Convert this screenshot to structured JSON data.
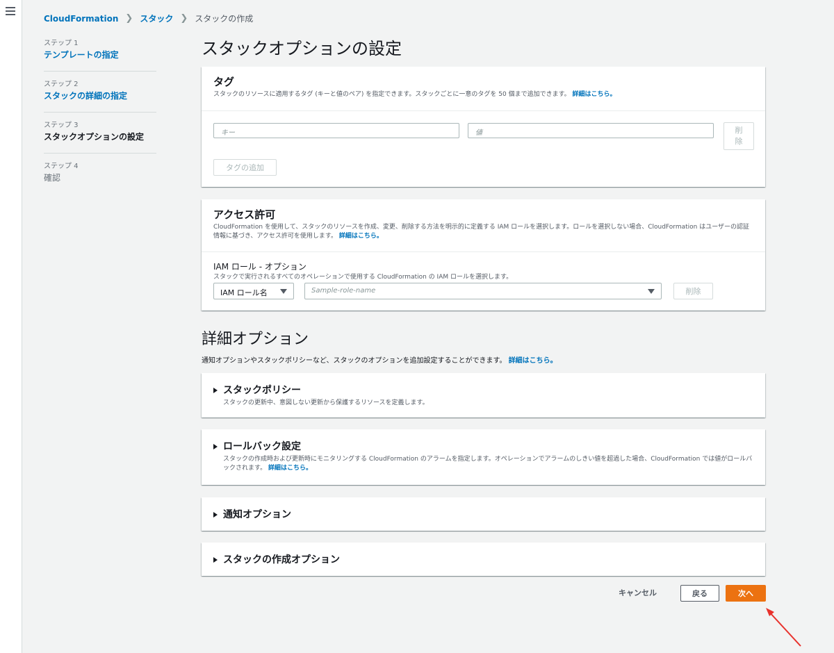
{
  "breadcrumb": {
    "root": "CloudFormation",
    "stacks": "スタック",
    "current": "スタックの作成"
  },
  "steps": [
    {
      "num": "ステップ 1",
      "label": "テンプレートの指定",
      "state": "link"
    },
    {
      "num": "ステップ 2",
      "label": "スタックの詳細の指定",
      "state": "link"
    },
    {
      "num": "ステップ 3",
      "label": "スタックオプションの設定",
      "state": "active"
    },
    {
      "num": "ステップ 4",
      "label": "確認",
      "state": "disabled"
    }
  ],
  "page_title": "スタックオプションの設定",
  "tags": {
    "title": "タグ",
    "desc": "スタックのリソースに適用するタグ (キーと値のペア) を指定できます。スタックごとに一意のタグを 50 個まで追加できます。",
    "link": "詳細はこちら。",
    "key_placeholder": "キー",
    "value_placeholder": "値",
    "remove_label": "削除",
    "add_label": "タグの追加"
  },
  "access": {
    "title": "アクセス許可",
    "desc": "CloudFormation を使用して、スタックのリソースを作成、変更、削除する方法を明示的に定義する IAM ロールを選択します。ロールを選択しない場合、CloudFormation はユーザーの認証情報に基づき、アクセス許可を使用します。",
    "link": "詳細はこちら。",
    "role_label": "IAM ロール - オプション",
    "role_desc": "スタックで実行されるすべてのオペレーションで使用する CloudFormation の IAM ロールを選択します。",
    "role_type": "IAM ロール名",
    "role_placeholder": "Sample-role-name",
    "remove_label": "削除"
  },
  "advanced": {
    "title": "詳細オプション",
    "desc": "通知オプションやスタックポリシーなど、スタックのオプションを追加設定することができます。",
    "link": "詳細はこちら。",
    "policy_title": "スタックポリシー",
    "policy_desc": "スタックの更新中、意図しない更新から保護するリソースを定義します。",
    "rollback_title": "ロールバック設定",
    "rollback_desc": "スタックの作成時および更新時にモニタリングする CloudFormation のアラームを指定します。オペレーションでアラームのしきい値を超過した場合、CloudFormation では値がロールバックされます。",
    "rollback_link": "詳細はこちら。",
    "notify_title": "通知オプション",
    "create_title": "スタックの作成オプション"
  },
  "footer": {
    "cancel": "キャンセル",
    "back": "戻る",
    "next": "次へ"
  },
  "colors": {
    "accent": "#0073bb",
    "primary_button": "#ec7211",
    "annotation_arrow": "#e8322d"
  }
}
